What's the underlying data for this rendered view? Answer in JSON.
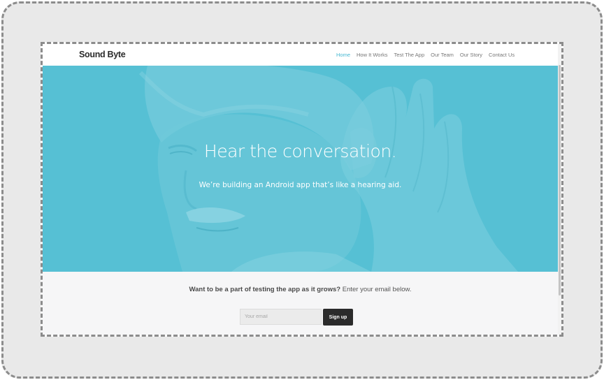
{
  "nav": {
    "brand": "Sound Byte",
    "links": [
      {
        "label": "Home",
        "active": true
      },
      {
        "label": "How It Works",
        "active": false
      },
      {
        "label": "Test The App",
        "active": false
      },
      {
        "label": "Our Team",
        "active": false
      },
      {
        "label": "Our Story",
        "active": false
      },
      {
        "label": "Contact Us",
        "active": false
      }
    ]
  },
  "hero": {
    "title": "Hear the conversation.",
    "subtitle": "We’re building an Android app that’s like a hearing aid.",
    "overlay_color": "#5bc3d6"
  },
  "signup": {
    "prompt_bold": "Want to be a part of testing the app as it grows?",
    "prompt_rest": " Enter your email below.",
    "email_placeholder": "Your email",
    "button_label": "Sign up"
  },
  "colors": {
    "accent": "#47b8d2",
    "button_bg": "#2b2b2b"
  }
}
